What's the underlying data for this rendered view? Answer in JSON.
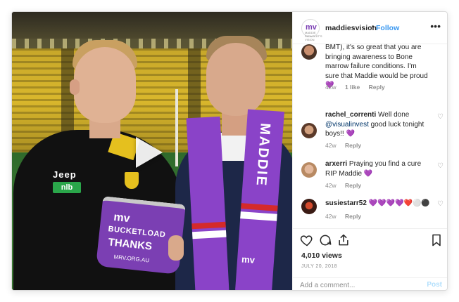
{
  "post": {
    "username": "maddiesvision",
    "follow_label": "Follow",
    "separator": "•",
    "more_label": "•••",
    "avatar_mark": "mv",
    "avatar_subtext": "MADDIE RIEWOLDT'S VISION"
  },
  "media": {
    "jersey_sponsor": "Jeep",
    "sleeve_sponsor": "nlb",
    "bucket_logo": "mv",
    "bucket_line1": "BUCKETLOAD",
    "bucket_line2": "THANKS",
    "bucket_url": "MRV.ORG.AU",
    "scarf_text": "MADDIE",
    "scarf_logo": "mv"
  },
  "comments": [
    {
      "text": "BMT), it's so great that you are bringing awareness to Bone marrow failure conditions. I'm sure that Maddie would be proud",
      "emoji": "💜",
      "age": "42w",
      "likes": "1 like",
      "reply": "Reply"
    },
    {
      "user": "rachel_correnti",
      "text_before": "Well done",
      "mention": "@visualinvest",
      "text_after": "good luck tonight boys!!",
      "emoji": "💜",
      "age": "42w",
      "reply": "Reply"
    },
    {
      "user": "arxerri",
      "text": "Praying you find a cure RIP Maddie",
      "emoji": "💜",
      "age": "42w",
      "reply": "Reply"
    },
    {
      "user": "susiestarr52",
      "emoji": "💜💜💜💜❤️⚪⚫",
      "age": "42w",
      "reply": "Reply"
    }
  ],
  "stats": {
    "views": "4,010 views",
    "date": "JULY 20, 2018"
  },
  "comment_box": {
    "placeholder": "Add a comment...",
    "post_label": "Post"
  },
  "colors": {
    "accent": "#3897f0",
    "brand_purple": "#8a43c8",
    "text": "#262626",
    "meta": "#8e8e8e"
  }
}
